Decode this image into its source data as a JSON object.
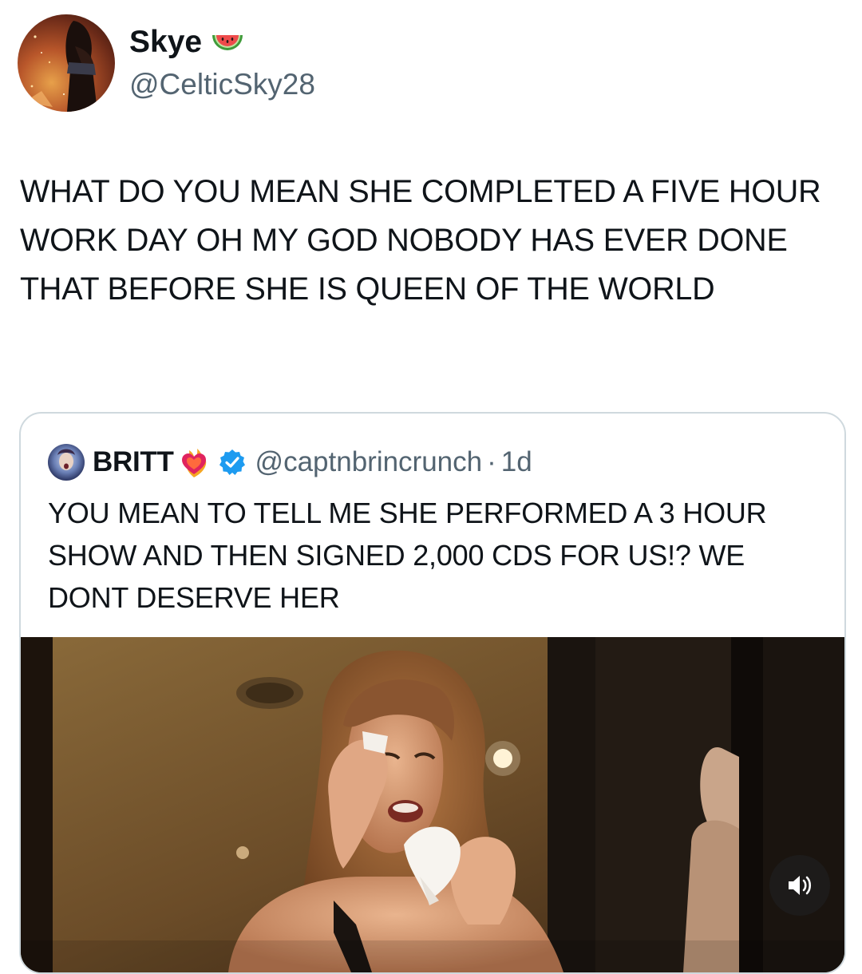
{
  "tweet": {
    "author": {
      "display_name": "Skye",
      "handle": "@CelticSky28",
      "avatar": "avatar",
      "name_emoji": "watermelon-icon"
    },
    "text": "WHAT DO YOU MEAN SHE COMPLETED A FIVE HOUR WORK DAY OH MY GOD NOBODY HAS EVER DONE THAT BEFORE SHE IS QUEEN OF THE WORLD"
  },
  "quoted_tweet": {
    "author": {
      "display_name": "BRITT",
      "name_emoji": "heart-on-fire-icon",
      "verified_icon": "verified-badge-icon",
      "handle": "@captnbrincrunch",
      "separator": "·",
      "time": "1d"
    },
    "text": "YOU MEAN TO TELL ME SHE PERFORMED A 3 HOUR SHOW AND THEN SIGNED 2,000 CDS FOR US!? WE DONT DESERVE HER",
    "media": {
      "type": "video",
      "controls": {
        "mute_icon": "speaker-icon"
      }
    }
  },
  "colors": {
    "text_primary": "#0f1419",
    "text_secondary": "#536471",
    "border": "#cfd9de",
    "verified_blue": "#1d9bf0"
  }
}
